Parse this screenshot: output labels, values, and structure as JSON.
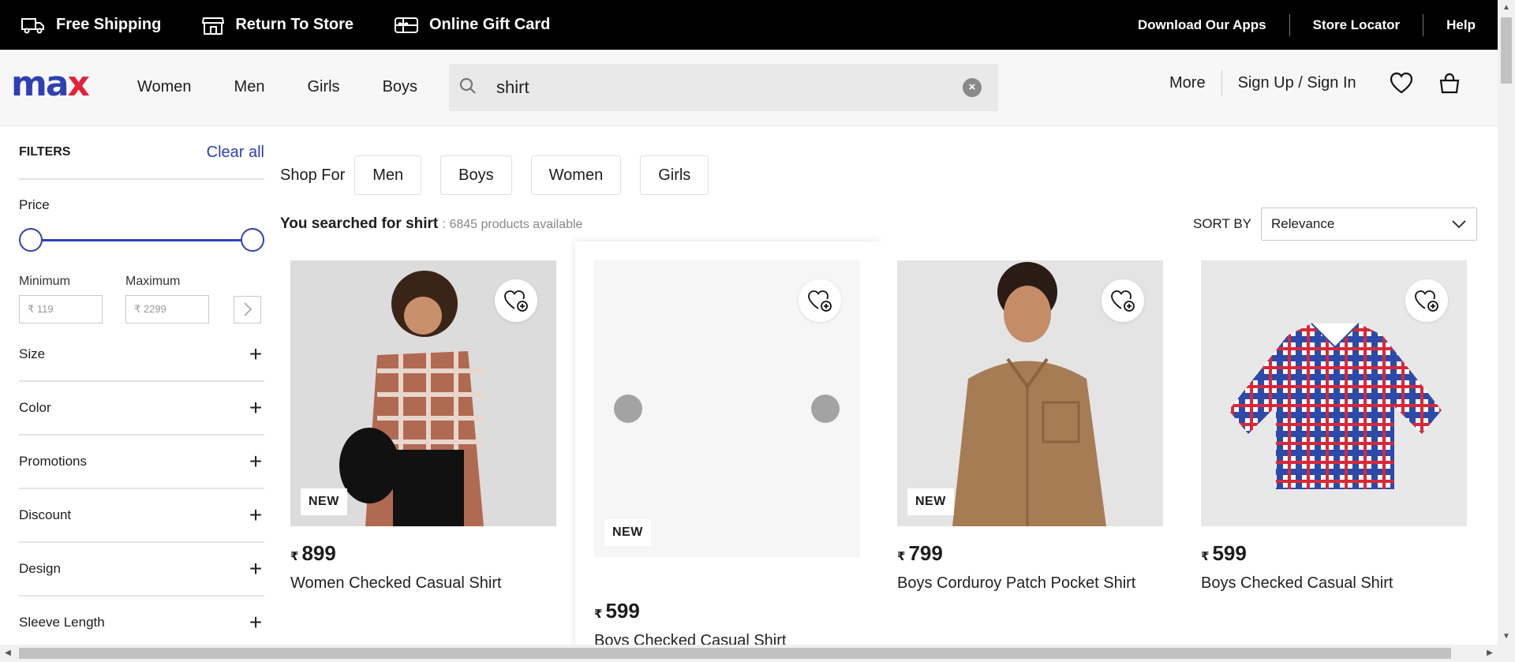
{
  "topbar": {
    "free_shipping": "Free Shipping",
    "return_to_store": "Return To Store",
    "gift_card": "Online Gift Card",
    "download_apps": "Download Our Apps",
    "store_locator": "Store Locator",
    "help": "Help"
  },
  "header": {
    "logo_m": "ma",
    "logo_x": "x",
    "nav": [
      "Women",
      "Men",
      "Girls",
      "Boys"
    ],
    "search_value": "shirt",
    "more": "More",
    "sign_in": "Sign Up / Sign In"
  },
  "colors": {
    "brand_blue": "#2f40b3",
    "brand_red": "#e2233b"
  },
  "filters": {
    "title": "FILTERS",
    "clear_all": "Clear all",
    "price": {
      "title": "Price",
      "range_low_fraction": 0.0,
      "range_high_fraction": 1.0,
      "min_label": "Minimum",
      "max_label": "Maximum",
      "min_placeholder": "₹ 119",
      "max_placeholder": "₹ 2299"
    },
    "facets": [
      "Size",
      "Color",
      "Promotions",
      "Discount",
      "Design",
      "Sleeve Length"
    ]
  },
  "shop_for": {
    "label": "Shop For",
    "options": [
      "Men",
      "Boys",
      "Women",
      "Girls"
    ]
  },
  "results": {
    "prefix": "You searched for shirt",
    "count": ": 6845 products available"
  },
  "sort": {
    "label": "SORT BY",
    "selected": "Relevance"
  },
  "products": [
    {
      "tag": "NEW",
      "currency": "₹",
      "price": "899",
      "name": "Women Checked Casual Shirt"
    },
    {
      "tag": "NEW",
      "currency": "₹",
      "price": "599",
      "name": "Boys Checked Casual Shirt"
    },
    {
      "tag": "NEW",
      "currency": "₹",
      "price": "799",
      "name": "Boys Corduroy Patch Pocket Shirt"
    },
    {
      "tag": "",
      "currency": "₹",
      "price": "599",
      "name": "Boys Checked Casual Shirt"
    }
  ]
}
